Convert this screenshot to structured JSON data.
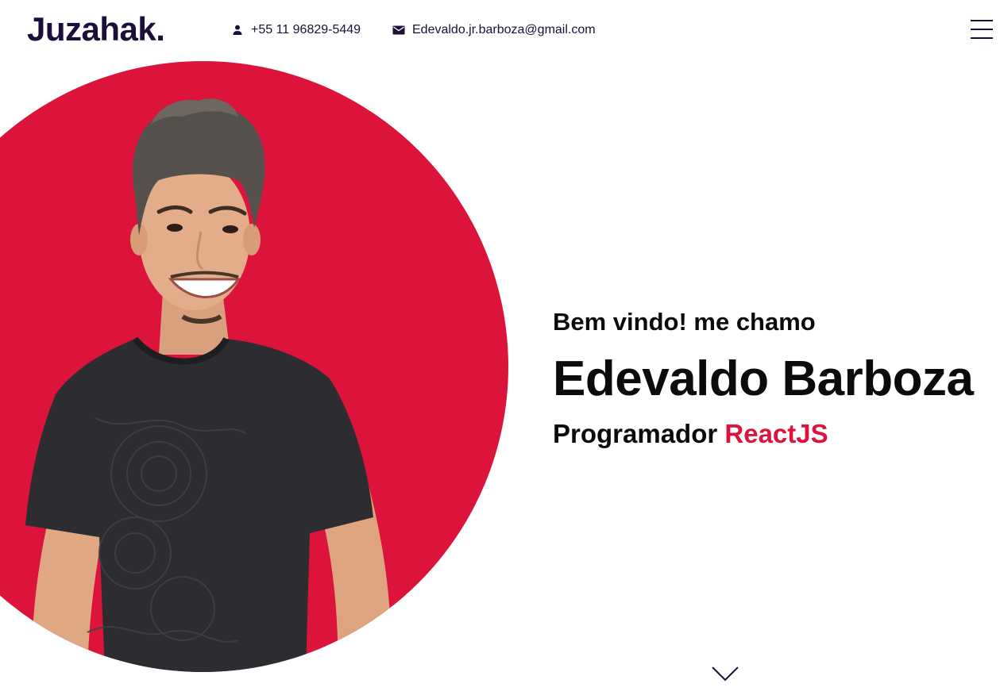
{
  "header": {
    "logo": "Juzahak.",
    "phone": {
      "icon": "person-icon",
      "text": "+55 11 96829-5449"
    },
    "email": {
      "icon": "mail-icon",
      "text": "Edevaldo.jr.barboza@gmail.com"
    },
    "menu_icon": "hamburger-menu-icon"
  },
  "hero": {
    "greeting": "Bem vindo! me chamo",
    "name": "Edevaldo Barboza",
    "role_prefix": "Programador",
    "role_highlight": "ReactJS",
    "scroll_icon": "chevron-down-icon"
  },
  "colors": {
    "accent": "#dc143c",
    "dark": "#1b0f3a",
    "text": "#0b0b0b",
    "background": "#ffffff"
  }
}
